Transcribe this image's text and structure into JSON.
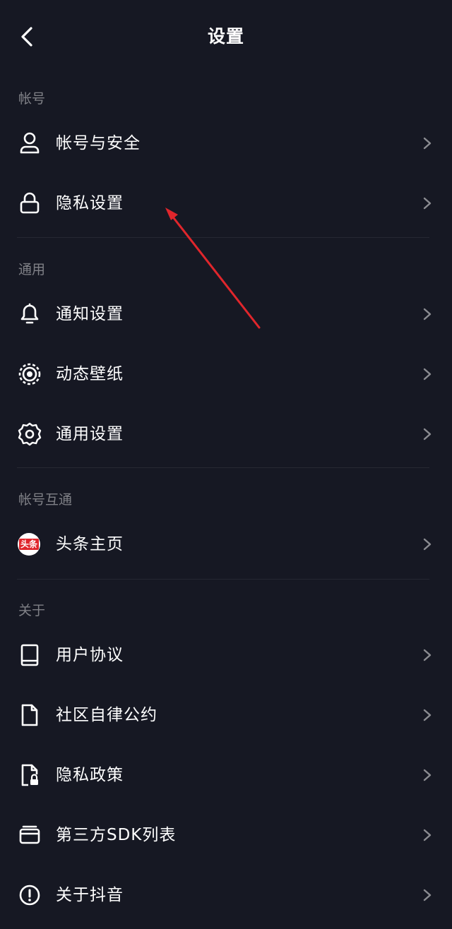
{
  "header": {
    "title": "设置"
  },
  "sections": {
    "account": "帐号",
    "general": "通用",
    "interop": "帐号互通",
    "about": "关于"
  },
  "rows": {
    "account_security": "帐号与安全",
    "privacy_settings": "隐私设置",
    "notification_settings": "通知设置",
    "live_wallpaper": "动态壁纸",
    "general_settings": "通用设置",
    "toutiao_home": "头条主页",
    "user_agreement": "用户协议",
    "community_guidelines": "社区自律公约",
    "privacy_policy": "隐私政策",
    "third_party_sdk": "第三方SDK列表",
    "about_douyin": "关于抖音"
  },
  "toutiao_logo_text": "头条",
  "colors": {
    "background": "#161823",
    "text": "#ffffff",
    "section_label": "rgba(255,255,255,0.45)",
    "annotation_arrow": "#e0262c"
  }
}
